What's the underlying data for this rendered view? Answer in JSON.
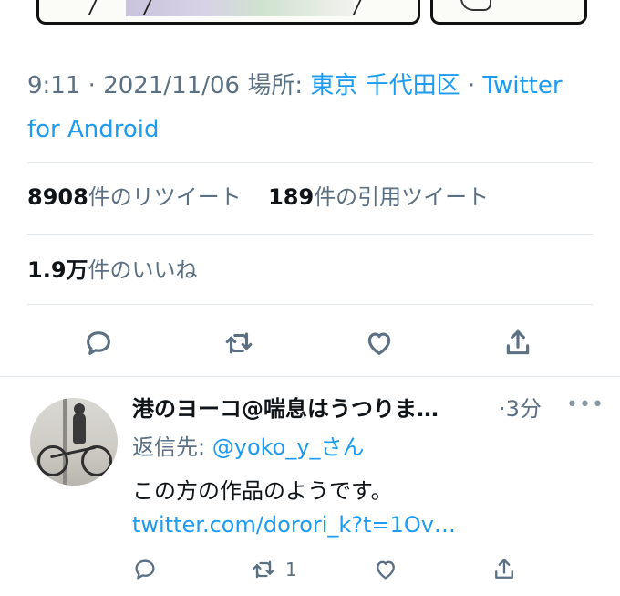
{
  "tweet": {
    "time": "9:11",
    "date": "2021/11/06",
    "place_label": "場所:",
    "place": "東京 千代田区",
    "separator": "·",
    "client": "Twitter for Android"
  },
  "stats": {
    "retweets_count": "8908",
    "retweets_label": "件のリツイート",
    "quotes_count": "189",
    "quotes_label": "件の引用ツイート",
    "likes_count": "1.9万",
    "likes_label": "件のいいね"
  },
  "actions": {
    "reply_icon": "reply-icon",
    "retweet_icon": "retweet-icon",
    "like_icon": "heart-icon",
    "share_icon": "share-icon"
  },
  "reply": {
    "display_name": "港のヨーコ@喘息はうつりま…",
    "time": "·3分",
    "more": "•••",
    "replying_to_label": "返信先:",
    "replying_to": "@yoko_y_さん",
    "text": "この方の作品のようです。",
    "link": "twitter.com/dorori_k?t=1Ov…",
    "retweet_count": "1"
  },
  "colors": {
    "accent": "#1d9bf0",
    "secondary_text": "#5b7083",
    "divider": "#e1e6ea"
  }
}
